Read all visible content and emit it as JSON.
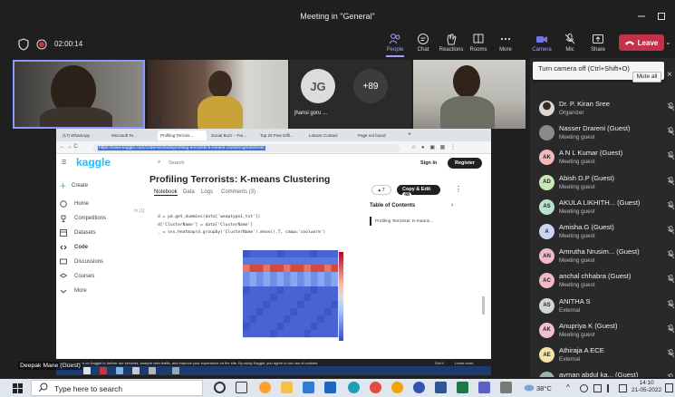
{
  "window": {
    "title": "Meeting in \"General\""
  },
  "meeting": {
    "elapsed": "02:00:14"
  },
  "toolbar": {
    "people": "People",
    "chat": "Chat",
    "reactions": "Reactions",
    "rooms": "Rooms",
    "more": "More",
    "camera": "Camera",
    "mic": "Mic",
    "share": "Share",
    "leave": "Leave"
  },
  "tiles": {
    "avatar_initials": "JG",
    "avatar_name": "jhansi goru ...",
    "overflow_count": "+89"
  },
  "tooltip": {
    "text": "Turn camera off (Ctrl+Shift+O)",
    "mute_all": "Mute all"
  },
  "participants": [
    {
      "initials": "",
      "name": "Dr. P. Kiran Sree",
      "role": "Organizer",
      "color": "#5b5b5b",
      "photo": true
    },
    {
      "initials": "",
      "name": "Nasser Drareni (Guest)",
      "role": "Meeting guest",
      "color": "#8a8a8a",
      "photo": false
    },
    {
      "initials": "AK",
      "name": "A N L Kumar (Guest)",
      "role": "Meeting guest",
      "color": "#f4b8b8"
    },
    {
      "initials": "AD",
      "name": "Abish D.P (Guest)",
      "role": "Meeting guest",
      "color": "#c9e7b6"
    },
    {
      "initials": "AS",
      "name": "AKULA LIKHITH...  (Guest)",
      "role": "Meeting guest",
      "color": "#b9e3cf"
    },
    {
      "initials": "A",
      "name": "Amisha.G (Guest)",
      "role": "Meeting guest",
      "color": "#c7d6f3"
    },
    {
      "initials": "AN",
      "name": "Amrutha Nrusim... (Guest)",
      "role": "Meeting guest",
      "color": "#f0b9c9"
    },
    {
      "initials": "AC",
      "name": "anchal chhabra (Guest)",
      "role": "Meeting guest",
      "color": "#f3b8c4"
    },
    {
      "initials": "AS",
      "name": "ANITHA S",
      "role": "External",
      "color": "#cfd8cf"
    },
    {
      "initials": "AK",
      "name": "Anupriya K (Guest)",
      "role": "Meeting guest",
      "color": "#f1c1cf"
    },
    {
      "initials": "AE",
      "name": "Athiraja A ECE",
      "role": "External",
      "color": "#f6e3a5"
    },
    {
      "initials": "",
      "name": "avman abdul ka...  (Guest)",
      "role": "",
      "color": "#9bb3a8"
    }
  ],
  "shared_screen": {
    "tabs": [
      "(17) WhatsApp",
      "Microsoft Te...",
      "Profiling Terroris...",
      "Social Buzz – Fre...",
      "Top 20 Free Diffi...",
      "Lebaze Contact",
      "Page not found"
    ],
    "url": "https://www.kaggle.com/code/sinchuts/profiling-terrorists-k-means-clustering/notebook",
    "kaggle": {
      "logo": "kaggle",
      "search": "Search",
      "signin": "Sign In",
      "register": "Register",
      "create": "Create",
      "nav": [
        "Home",
        "Competitions",
        "Datasets",
        "Code",
        "Discussions",
        "Courses",
        "More"
      ],
      "nb_title": "Profiling Terrorists: K-means Clustering",
      "nb_tabs": [
        "Notebook",
        "Data",
        "Logs",
        "Comments (3)"
      ],
      "vote_count": "7",
      "copy_edit": "Copy & Edit",
      "copy_count": "48",
      "cell_label": "In [1]:",
      "code": [
        "d = pd.get_dummies(data['weaptype1_txt'])",
        "d['ClusterName'] = data['ClusterName']",
        "_ = sns.heatmap(d.groupby('ClusterName').mean().T, cmap='coolwarm')"
      ],
      "toc_title": "Table of Contents",
      "toc_item": "Profiling Terrorists: K-means..."
    },
    "cookie": "We use cookies on Kaggle to deliver our services, analyze web traffic, and improve your experience on the site. By using Kaggle, you agree to our use of cookies.",
    "cookie_ok": "Got it",
    "cookie_more": "Learn more"
  },
  "caption": "Deepak Mane (Guest)",
  "taskbar": {
    "search": "Type here to search",
    "temp": "38°C",
    "time": "14:10",
    "date": "21-05-2022"
  }
}
